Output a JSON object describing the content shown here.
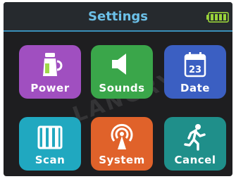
{
  "header": {
    "title": "Settings",
    "title_color": "#6cc0e8",
    "battery_icon": "battery-full-icon",
    "battery_color": "#9ad43a"
  },
  "tiles": [
    {
      "label": "Power",
      "icon": "kettle-icon",
      "color": "#a04fc0"
    },
    {
      "label": "Sounds",
      "icon": "speaker-icon",
      "color": "#3aa64a"
    },
    {
      "label": "Date",
      "icon": "calendar-icon",
      "color": "#3b5fc2",
      "calendar_day": "23"
    },
    {
      "label": "Scan",
      "icon": "piano-keys-icon",
      "color": "#20a8c0"
    },
    {
      "label": "System",
      "icon": "broadcast-icon",
      "color": "#e0622a"
    },
    {
      "label": "Cancel",
      "icon": "running-man-icon",
      "color": "#1f8f8a"
    }
  ],
  "watermark": "LANGRY"
}
